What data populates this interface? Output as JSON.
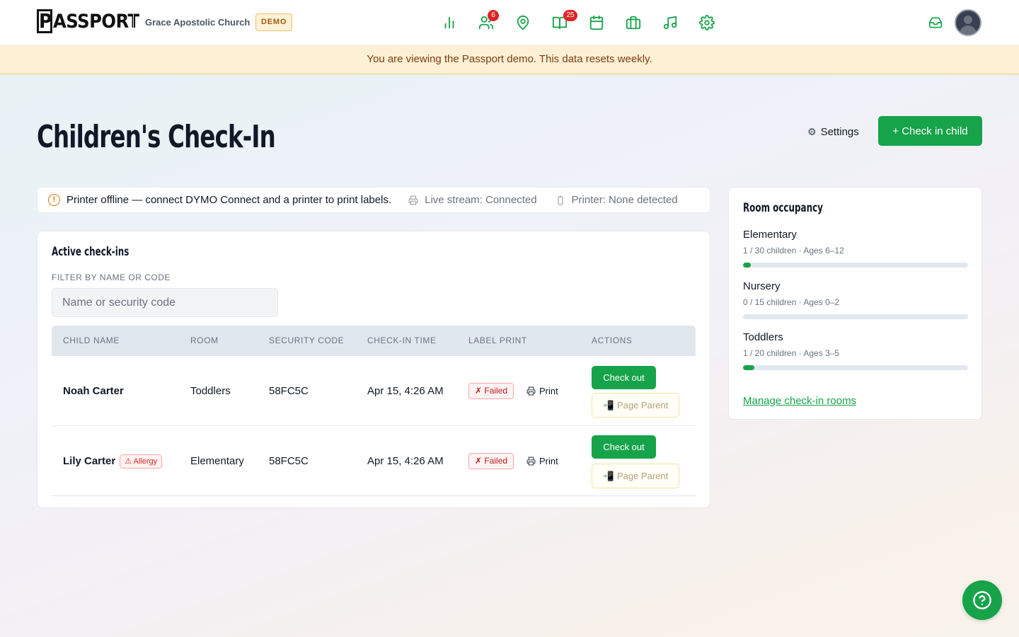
{
  "header": {
    "logo_letter": "P",
    "logo_rest": "ASSPORT",
    "org_name": "Grace Apostolic Church",
    "demo_badge": "DEMO",
    "nav": [
      {
        "icon": "bar-chart-icon",
        "badge": ""
      },
      {
        "icon": "users-icon",
        "badge": "6"
      },
      {
        "icon": "map-pin-icon",
        "badge": ""
      },
      {
        "icon": "book-icon",
        "badge": "25"
      },
      {
        "icon": "calendar-icon",
        "badge": ""
      },
      {
        "icon": "briefcase-icon",
        "badge": ""
      },
      {
        "icon": "music-icon",
        "badge": ""
      },
      {
        "icon": "gear-icon",
        "badge": ""
      }
    ]
  },
  "banner": {
    "text": "You are viewing the Passport demo. This data resets weekly."
  },
  "page": {
    "title": "Children's Check-In",
    "settings_label": "Settings",
    "primary_action": "+ Check in child"
  },
  "status": {
    "message": "Printer offline — connect DYMO Connect and a printer to print labels.",
    "stream": "Live stream: Connected",
    "printer": "Printer: None detected"
  },
  "checkins": {
    "title": "Active check-ins",
    "filter_label": "FILTER BY NAME OR CODE",
    "filter_placeholder": "Name or security code",
    "columns": [
      "CHILD NAME",
      "ROOM",
      "SECURITY CODE",
      "CHECK-IN TIME",
      "LABEL PRINT",
      "ACTIONS"
    ],
    "rows": [
      {
        "name": "Noah Carter",
        "allergy": "",
        "room": "Toddlers",
        "code": "58FC5C",
        "time": "Apr 15, 4:26 AM",
        "label_status": "✗ Failed",
        "print": "Print",
        "checkout": "Check out",
        "page_parent": "Page Parent"
      },
      {
        "name": "Lily Carter",
        "allergy": "⚠ Allergy",
        "room": "Elementary",
        "code": "58FC5C",
        "time": "Apr 15, 4:26 AM",
        "label_status": "✗ Failed",
        "print": "Print",
        "checkout": "Check out",
        "page_parent": "Page Parent"
      }
    ]
  },
  "rooms": {
    "title": "Room occupancy",
    "items": [
      {
        "name": "Elementary",
        "meta": "1 / 30 children · Ages 6–12",
        "occupancy": 0.033
      },
      {
        "name": "Nursery",
        "meta": "0 / 15 children · Ages 0–2",
        "occupancy": 0
      },
      {
        "name": "Toddlers",
        "meta": "1 / 20 children · Ages 3–5",
        "occupancy": 0.05
      }
    ],
    "manage_link": "Manage check-in rooms"
  },
  "colors": {
    "accent": "#16a34a",
    "danger": "#dc2626",
    "banner_bg": "#fdf0d4"
  }
}
